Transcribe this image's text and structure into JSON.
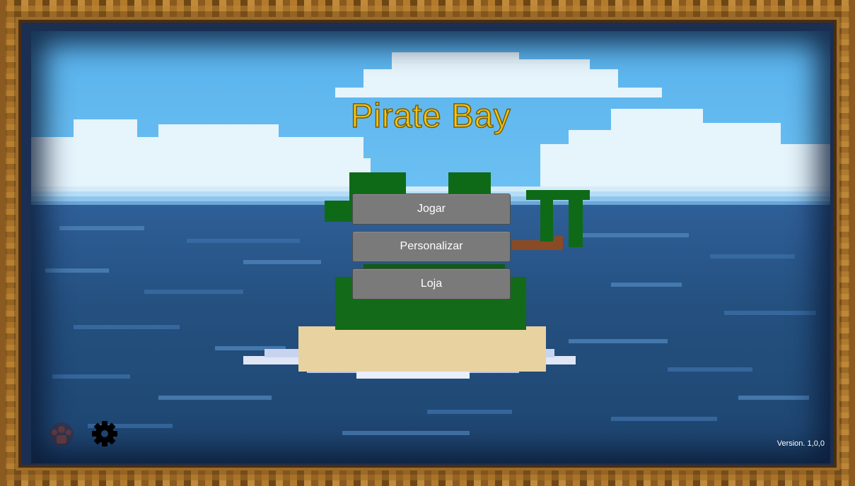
{
  "game": {
    "title": "Pirate Bay",
    "version": "Version. 1,0,0"
  },
  "menu": {
    "play_label": "Jogar",
    "customize_label": "Personalizar",
    "shop_label": "Loja"
  },
  "icons": {
    "achievements": "achievements-icon",
    "settings": "gear-icon"
  },
  "colors": {
    "title": "#f0c418",
    "button": "#7a7a7a",
    "button_text": "#ffffff"
  }
}
